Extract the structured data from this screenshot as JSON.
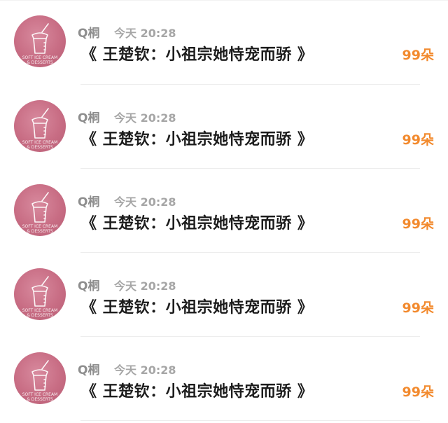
{
  "items": [
    {
      "username": "Q桐",
      "time": "今天 20:28",
      "title": "《 王楚钦：小祖宗她恃宠而骄 》",
      "count": "99朵",
      "avatar_icon": "ice-cream-cup-avatar"
    },
    {
      "username": "Q桐",
      "time": "今天 20:28",
      "title": "《 王楚钦：小祖宗她恃宠而骄 》",
      "count": "99朵",
      "avatar_icon": "ice-cream-cup-avatar"
    },
    {
      "username": "Q桐",
      "time": "今天 20:28",
      "title": "《 王楚钦：小祖宗她恃宠而骄 》",
      "count": "99朵",
      "avatar_icon": "ice-cream-cup-avatar"
    },
    {
      "username": "Q桐",
      "time": "今天 20:28",
      "title": "《 王楚钦：小祖宗她恃宠而骄 》",
      "count": "99朵",
      "avatar_icon": "ice-cream-cup-avatar"
    },
    {
      "username": "Q桐",
      "time": "今天 20:28",
      "title": "《 王楚钦：小祖宗她恃宠而骄 》",
      "count": "99朵",
      "avatar_icon": "ice-cream-cup-avatar"
    }
  ],
  "avatar_text": {
    "line1": "SOFT ICE CREAM",
    "line2": "& DESSERTS"
  },
  "colors": {
    "count": "#f28a2e",
    "title": "#1c1c1c",
    "meta": "#a6a6a6",
    "avatar": "#c86d84"
  }
}
